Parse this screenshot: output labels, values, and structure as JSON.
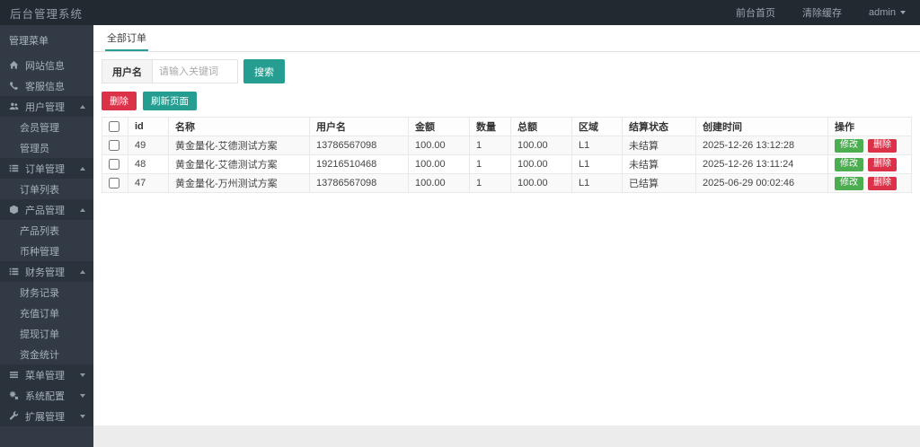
{
  "colors": {
    "teal": "#259d90",
    "red": "#db3149",
    "green": "#4cae51"
  },
  "topbar": {
    "title": "后台管理系统",
    "links": [
      {
        "name": "front-home",
        "label": "前台首页"
      },
      {
        "name": "clear-cache",
        "label": "清除缓存"
      }
    ],
    "user": "admin"
  },
  "sidebar": {
    "header": "管理菜单",
    "items": [
      {
        "name": "site-info",
        "label": "网站信息",
        "icon": "home-icon",
        "type": "item"
      },
      {
        "name": "service-info",
        "label": "客服信息",
        "icon": "phone-icon",
        "type": "item"
      },
      {
        "name": "user-mgmt",
        "label": "用户管理",
        "icon": "users-icon",
        "type": "parent",
        "expanded": true
      },
      {
        "name": "member-mgmt",
        "label": "会员管理",
        "type": "child"
      },
      {
        "name": "admin-list",
        "label": "管理员",
        "type": "child"
      },
      {
        "name": "order-mgmt",
        "label": "订单管理",
        "icon": "list-icon",
        "type": "parent",
        "expanded": true
      },
      {
        "name": "order-list",
        "label": "订单列表",
        "type": "child"
      },
      {
        "name": "product-mgmt",
        "label": "产品管理",
        "icon": "cube-icon",
        "type": "parent",
        "expanded": true
      },
      {
        "name": "product-list",
        "label": "产品列表",
        "type": "child"
      },
      {
        "name": "currency-mgmt",
        "label": "币种管理",
        "type": "child"
      },
      {
        "name": "finance-mgmt",
        "label": "财务管理",
        "icon": "list-icon",
        "type": "parent",
        "expanded": true
      },
      {
        "name": "finance-records",
        "label": "财务记录",
        "type": "child"
      },
      {
        "name": "recharge-orders",
        "label": "充值订单",
        "type": "child"
      },
      {
        "name": "withdraw-orders",
        "label": "提现订单",
        "type": "child"
      },
      {
        "name": "funds-stats",
        "label": "资金统计",
        "type": "child"
      },
      {
        "name": "menu-mgmt",
        "label": "菜单管理",
        "icon": "menu-icon",
        "type": "parent",
        "expanded": false
      },
      {
        "name": "system-config",
        "label": "系统配置",
        "icon": "gears-icon",
        "type": "parent",
        "expanded": false
      },
      {
        "name": "extension-mgmt",
        "label": "扩展管理",
        "icon": "wrench-icon",
        "type": "parent",
        "expanded": false
      }
    ]
  },
  "main": {
    "tab": "全部订单",
    "search": {
      "label": "用户名",
      "placeholder": "请输入关键词",
      "button": "搜索"
    },
    "toolbar": {
      "delete": "删除",
      "refresh": "刷新页面"
    },
    "table": {
      "headers": [
        "id",
        "名称",
        "用户名",
        "金额",
        "数量",
        "总额",
        "区域",
        "结算状态",
        "创建时间",
        "操作"
      ],
      "row_actions": {
        "edit": "修改",
        "delete": "删除"
      },
      "rows": [
        {
          "id": "49",
          "name": "黄金量化-艾德测试方案",
          "username": "13786567098",
          "amount": "100.00",
          "qty": "1",
          "total": "100.00",
          "area": "L1",
          "status": "未结算",
          "created": "2025-12-26 13:12:28"
        },
        {
          "id": "48",
          "name": "黄金量化-艾德测试方案",
          "username": "19216510468",
          "amount": "100.00",
          "qty": "1",
          "total": "100.00",
          "area": "L1",
          "status": "未结算",
          "created": "2025-12-26 13:11:24"
        },
        {
          "id": "47",
          "name": "黄金量化-万州测试方案",
          "username": "13786567098",
          "amount": "100.00",
          "qty": "1",
          "total": "100.00",
          "area": "L1",
          "status": "已结算",
          "created": "2025-06-29 00:02:46"
        }
      ]
    }
  }
}
